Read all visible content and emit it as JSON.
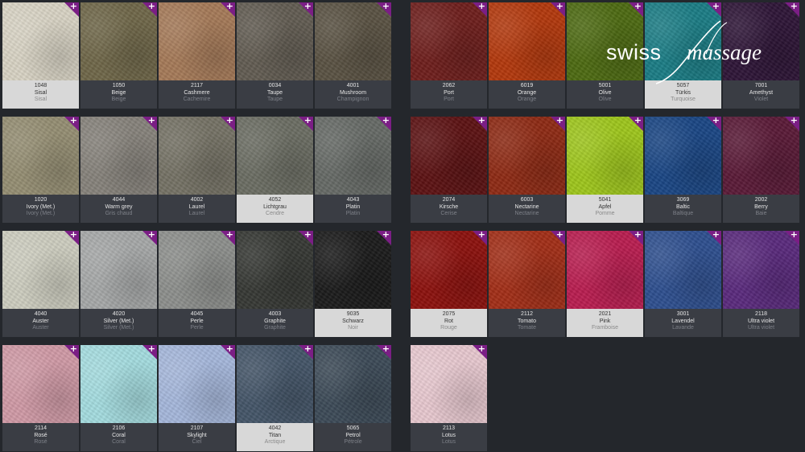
{
  "logo": {
    "word1": "swiss",
    "word2": "massage"
  },
  "left_colors": [
    {
      "code": "1048",
      "name": "Sisal",
      "name_fr": "Sisal",
      "color": "#d8d3c4",
      "light": true
    },
    {
      "code": "1050",
      "name": "Beige",
      "name_fr": "Beige",
      "color": "#6f6749",
      "light": false
    },
    {
      "code": "2117",
      "name": "Cashmere",
      "name_fr": "Cachemire",
      "color": "#a57a58",
      "light": false
    },
    {
      "code": "0034",
      "name": "Taupe",
      "name_fr": "Taupe",
      "color": "#625c52",
      "light": false
    },
    {
      "code": "4001",
      "name": "Mushroom",
      "name_fr": "Champignon",
      "color": "#5a5243",
      "light": false
    },
    {
      "code": "1020",
      "name": "Ivory (Met.)",
      "name_fr": "Ivory (Met.)",
      "color": "#958e73",
      "light": false
    },
    {
      "code": "4044",
      "name": "Warm grey",
      "name_fr": "Gris chaud",
      "color": "#86827b",
      "light": false
    },
    {
      "code": "4002",
      "name": "Laurel",
      "name_fr": "Laurel",
      "color": "#757265",
      "light": false
    },
    {
      "code": "4052",
      "name": "Lichtgrau",
      "name_fr": "Cendre",
      "color": "#6b6d63",
      "light": true
    },
    {
      "code": "4043",
      "name": "Platin",
      "name_fr": "Platin",
      "color": "#666a66",
      "light": false
    },
    {
      "code": "4040",
      "name": "Auster",
      "name_fr": "Auster",
      "color": "#cdcdbf",
      "light": false
    },
    {
      "code": "4020",
      "name": "Silver (Met.)",
      "name_fr": "Silver (Met.)",
      "color": "#a6a8a8",
      "light": false
    },
    {
      "code": "4045",
      "name": "Perle",
      "name_fr": "Perle",
      "color": "#8d8f8c",
      "light": false
    },
    {
      "code": "4003",
      "name": "Graphite",
      "name_fr": "Graphite",
      "color": "#363834",
      "light": false
    },
    {
      "code": "9035",
      "name": "Schwarz",
      "name_fr": "Noir",
      "color": "#1b1b1b",
      "light": true
    },
    {
      "code": "2114",
      "name": "Rosé",
      "name_fr": "Rosé",
      "color": "#d09aa6",
      "light": false
    },
    {
      "code": "2106",
      "name": "Coral",
      "name_fr": "Coral",
      "color": "#a4dcdf",
      "light": false
    },
    {
      "code": "2107",
      "name": "Skylight",
      "name_fr": "Ciel",
      "color": "#a5b7db",
      "light": false
    },
    {
      "code": "4042",
      "name": "Titan",
      "name_fr": "Arctique",
      "color": "#445568",
      "light": true
    },
    {
      "code": "5065",
      "name": "Petrol",
      "name_fr": "Pétrole",
      "color": "#3c4a57",
      "light": false
    }
  ],
  "right_colors": [
    {
      "code": "2062",
      "name": "Port",
      "name_fr": "Port",
      "color": "#6e1e1c",
      "light": false
    },
    {
      "code": "6019",
      "name": "Orange",
      "name_fr": "Orange",
      "color": "#b3380c",
      "light": false
    },
    {
      "code": "5001",
      "name": "Olive",
      "name_fr": "Olive",
      "color": "#4d6a12",
      "light": false
    },
    {
      "code": "5057",
      "name": "Türkis",
      "name_fr": "Turquoise",
      "color": "#1b7d85",
      "light": true
    },
    {
      "code": "7001",
      "name": "Amethyst",
      "name_fr": "Violet",
      "color": "#2e1537",
      "light": false
    },
    {
      "code": "2074",
      "name": "Kirsche",
      "name_fr": "Cerise",
      "color": "#5c1213",
      "light": false
    },
    {
      "code": "6003",
      "name": "Nectarine",
      "name_fr": "Nectarine",
      "color": "#8e2a14",
      "light": false
    },
    {
      "code": "5041",
      "name": "Apfel",
      "name_fr": "Pomme",
      "color": "#9ec61c",
      "light": true
    },
    {
      "code": "3069",
      "name": "Baltic",
      "name_fr": "Baltique",
      "color": "#1a4684",
      "light": false
    },
    {
      "code": "2002",
      "name": "Berry",
      "name_fr": "Baie",
      "color": "#5a1a37",
      "light": false
    },
    {
      "code": "2075",
      "name": "Rot",
      "name_fr": "Rouge",
      "color": "#8c110d",
      "light": true
    },
    {
      "code": "2112",
      "name": "Tomato",
      "name_fr": "Tomate",
      "color": "#a22e17",
      "light": false
    },
    {
      "code": "2021",
      "name": "Pink",
      "name_fr": "Framboise",
      "color": "#b91d50",
      "light": true
    },
    {
      "code": "3001",
      "name": "Lavendel",
      "name_fr": "Lavande",
      "color": "#2e4f8f",
      "light": false
    },
    {
      "code": "2118",
      "name": "Ultra violet",
      "name_fr": "Ultra violet",
      "color": "#5a2a7d",
      "light": false
    },
    {
      "code": "2113",
      "name": "Lotus",
      "name_fr": "Lotus",
      "color": "#e7c8cf",
      "light": false
    }
  ]
}
